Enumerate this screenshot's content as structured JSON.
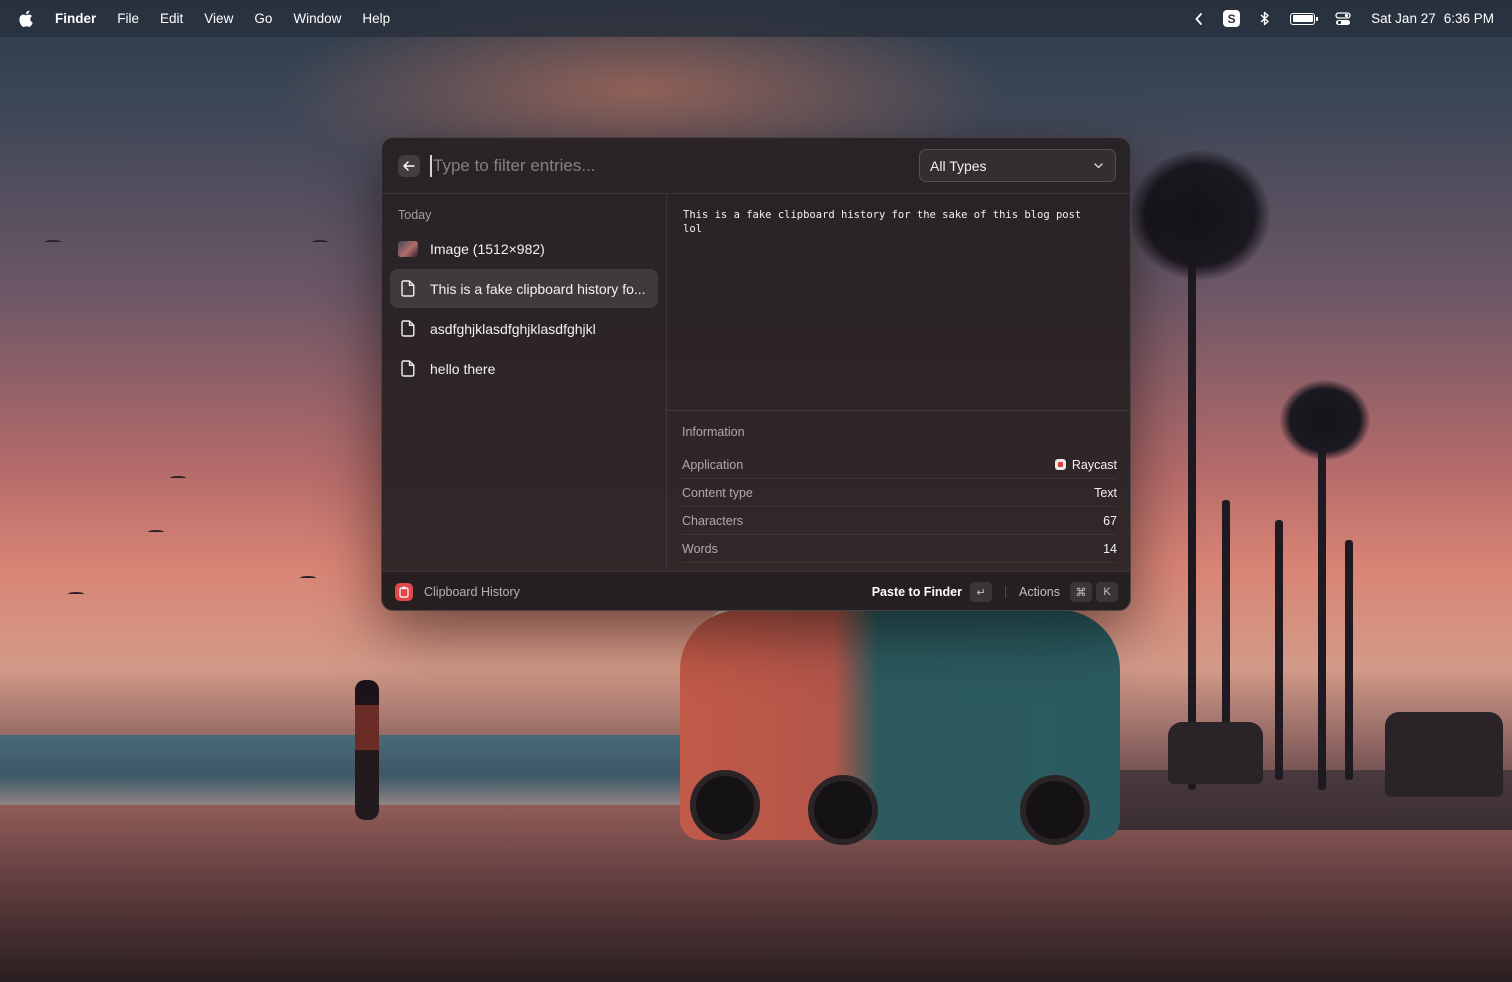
{
  "menubar": {
    "app_name": "Finder",
    "menus": [
      "File",
      "Edit",
      "View",
      "Go",
      "Window",
      "Help"
    ],
    "status_icons": [
      "chevron-left-icon",
      "s-app-icon",
      "bluetooth-icon",
      "battery-icon",
      "control-center-icon"
    ],
    "s_badge": "S",
    "battery_level": 1.0,
    "date": "Sat Jan 27",
    "time": "6:36 PM"
  },
  "raycast": {
    "search": {
      "placeholder": "Type to filter entries...",
      "value": ""
    },
    "type_filter": {
      "selected": "All Types"
    },
    "list": {
      "section_title": "Today",
      "items": [
        {
          "label": "Image (1512×982)",
          "icon": "image-thumbnail",
          "selected": false
        },
        {
          "label": "This is a fake clipboard history fo...",
          "icon": "document-icon",
          "selected": true
        },
        {
          "label": "asdfghjklasdfghjklasdfghjkl",
          "icon": "document-icon",
          "selected": false
        },
        {
          "label": "hello there",
          "icon": "document-icon",
          "selected": false
        }
      ]
    },
    "detail": {
      "preview_text": "This is a fake clipboard history for the sake of this blog post\nlol",
      "info_title": "Information",
      "rows": [
        {
          "key": "Application",
          "value": "Raycast"
        },
        {
          "key": "Content type",
          "value": "Text"
        },
        {
          "key": "Characters",
          "value": "67"
        },
        {
          "key": "Words",
          "value": "14"
        }
      ]
    },
    "footer": {
      "extension_name": "Clipboard History",
      "primary_action": "Paste to Finder",
      "primary_shortcut": "↵",
      "actions_label": "Actions",
      "actions_shortcut": [
        "⌘",
        "K"
      ]
    }
  },
  "colors": {
    "accent_red": "#e0484c",
    "menubar_bg": "#28303c",
    "window_bg": "#262022"
  }
}
